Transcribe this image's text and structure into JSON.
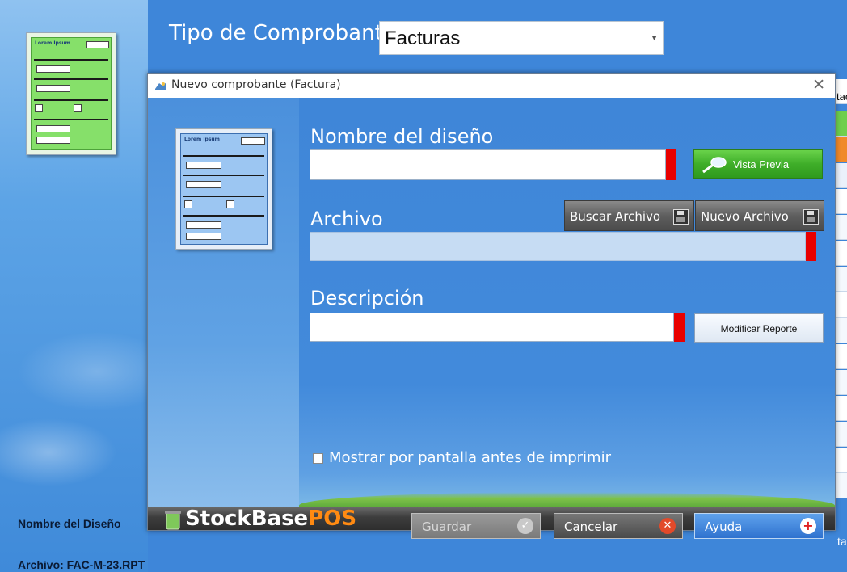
{
  "background": {
    "tipo_label": "Tipo de Comprobante:",
    "tipo_value": "Facturas",
    "nombre_label": "Nombre del Diseño",
    "archivo_label": "Archivo: FAC-M-23.RPT",
    "right_fragment_top": "tac",
    "right_fragment_bottom": "ta"
  },
  "dialog": {
    "title": "Nuevo comprobante (Factura)",
    "nombre_label": "Nombre del diseño",
    "nombre_value": "",
    "vista_previa": "Vista Previa",
    "archivo_label": "Archivo",
    "archivo_value": "",
    "buscar_archivo": "Buscar Archivo",
    "nuevo_archivo": "Nuevo Archivo",
    "descripcion_label": "Descripción",
    "descripcion_value": "",
    "modificar_reporte": "Modificar Reporte",
    "mostrar_checkbox": "Mostrar por pantalla antes de imprimir",
    "brand_main": "StockBase",
    "brand_accent": "POS",
    "guardar": "Guardar",
    "cancelar": "Cancelar",
    "ayuda": "Ayuda"
  },
  "doc_thumb": {
    "title": "Lorem Ipsum"
  },
  "colors": {
    "background": "#3f86d8",
    "required": "#e80000",
    "green_button": "#3fae29",
    "brand_accent": "#ff8a12"
  }
}
